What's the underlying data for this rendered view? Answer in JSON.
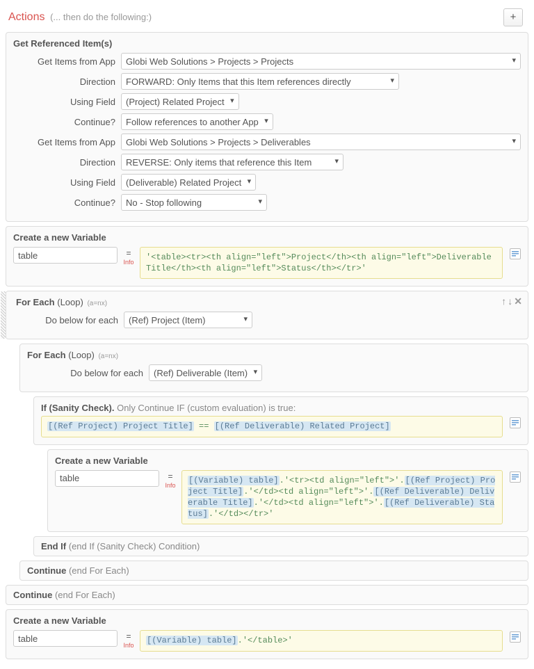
{
  "header": {
    "title": "Actions",
    "subtitle": "(... then do the following:)",
    "add": "+"
  },
  "getRef": {
    "title": "Get Referenced Item(s)",
    "labels": {
      "app": "Get Items from App",
      "dir": "Direction",
      "field": "Using Field",
      "cont": "Continue?"
    },
    "app1": "Globi Web Solutions > Projects > Projects",
    "dir1": "FORWARD: Only Items that this Item references directly",
    "field1": "(Project) Related Project",
    "cont1": "Follow references to another App",
    "app2": "Globi Web Solutions > Projects > Deliverables",
    "dir2": "REVERSE: Only items that reference this Item",
    "field2": "(Deliverable) Related Project",
    "cont2": "No - Stop following"
  },
  "var1": {
    "title": "Create a new Variable",
    "name": "table",
    "eq": "=",
    "info": "Info",
    "code": "'<table><tr><th align=\"left\">Project</th><th align=\"left\">Deliverable Title</th><th align=\"left\">Status</th></tr>'"
  },
  "loop1": {
    "title": "For Each",
    "sub": "(Loop)",
    "anx": "(a=nx)",
    "label": "Do below for each",
    "select": "(Ref) Project (Item)"
  },
  "loop2": {
    "title": "For Each",
    "sub": "(Loop)",
    "anx": "(a=nx)",
    "label": "Do below for each",
    "select": "(Ref) Deliverable (Item)"
  },
  "ifCheck": {
    "title": "If (Sanity Check).",
    "sub": "Only Continue IF (custom evaluation) is true:",
    "tok1": "[(Ref Project) Project Title]",
    "mid": " == ",
    "tok2": "[(Ref Deliverable) Related Project]"
  },
  "var2": {
    "title": "Create a new Variable",
    "name": "table",
    "eq": "=",
    "info": "Info",
    "tok1": "[(Variable) table]",
    "s1": ".'<tr><td align=\"left\">'.",
    "tok2": "[(Ref Project) Project Title]",
    "s2": ".'</td><td align=\"left\">'.",
    "tok3": "[(Ref Deliverable) Deliverable Title]",
    "s3": ".'</td><td align=\"left\">'.",
    "tok4": "[(Ref Deliverable) Status]",
    "s4": ".'</td></tr>'"
  },
  "endIf": {
    "title": "End If",
    "sub": "(end If (Sanity Check) Condition)"
  },
  "cont1": {
    "title": "Continue",
    "sub": "(end For Each)"
  },
  "cont2": {
    "title": "Continue",
    "sub": "(end For Each)"
  },
  "var3": {
    "title": "Create a new Variable",
    "name": "table",
    "eq": "=",
    "info": "Info",
    "tok1": "[(Variable) table]",
    "s1": ".'</table>'"
  }
}
